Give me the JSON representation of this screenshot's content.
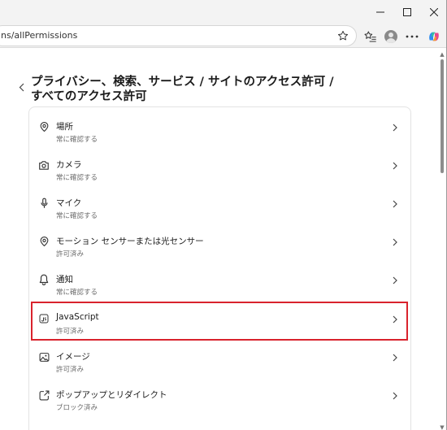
{
  "browser": {
    "url": "ns/allPermissions"
  },
  "page": {
    "title_line1": "プライバシー、検索、サービス / サイトのアクセス許可 /",
    "title_line2": "すべてのアクセス許可"
  },
  "permissions": [
    {
      "title": "場所",
      "status": "常に確認する",
      "icon": "location-pin-icon"
    },
    {
      "title": "カメラ",
      "status": "常に確認する",
      "icon": "camera-icon"
    },
    {
      "title": "マイク",
      "status": "常に確認する",
      "icon": "microphone-icon"
    },
    {
      "title": "モーション センサーまたは光センサー",
      "status": "許可済み",
      "icon": "motion-sensor-icon"
    },
    {
      "title": "通知",
      "status": "常に確認する",
      "icon": "bell-icon"
    },
    {
      "title": "JavaScript",
      "status": "許可済み",
      "icon": "javascript-icon"
    },
    {
      "title": "イメージ",
      "status": "許可済み",
      "icon": "image-icon"
    },
    {
      "title": "ポップアップとリダイレクト",
      "status": "ブロック済み",
      "icon": "popup-redirect-icon"
    }
  ],
  "colors": {
    "highlight": "#d9232d"
  }
}
